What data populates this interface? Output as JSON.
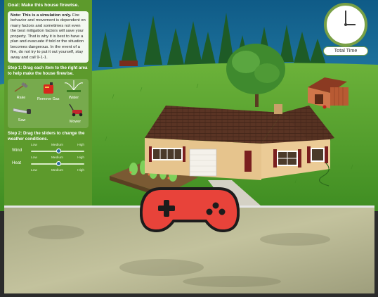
{
  "sidebar": {
    "goal_label": "Goal:",
    "goal_text": "Make this house firewise.",
    "note_label": "Note: This is a simulation only.",
    "note_text": "Fire behavior and movement is dependent on many factors and sometimes not even the best mitigation factors will save your property. That is why it is best to have a plan and evacuate if told or the situation becomes dangerous. In the event of a fire, do not try to put it out yourself, stay away and call 9-1-1.",
    "step1": "Step 1: Drag each item to the right area to help make the house firewise.",
    "items": [
      {
        "label": "Rake"
      },
      {
        "label": "Remove Gas"
      },
      {
        "label": "Water"
      },
      {
        "label": "Saw"
      },
      {
        "label": "Mower"
      }
    ],
    "step2": "Step 2: Drag the sliders to change the weather conditions.",
    "sliders": [
      {
        "name": "Wind",
        "scale": [
          "Low",
          "Medium",
          "High"
        ],
        "level": 0.52
      },
      {
        "name": "Heat",
        "scale": [
          "Low",
          "Medium",
          "High"
        ],
        "level": 0.52
      },
      {
        "name": "",
        "scale": [
          "Low",
          "Medium",
          "High"
        ],
        "level": 0.5
      }
    ]
  },
  "clock": {
    "label": "Total Time"
  },
  "colors": {
    "sidebar": "#5d9a2c",
    "grass": "#4f9d2a",
    "sky": "#1f6f9c",
    "roof": "#5a3424",
    "gamepad": "#e8433a"
  },
  "icons": {
    "play_overlay": "gamepad-icon",
    "clock": "clock-icon"
  }
}
